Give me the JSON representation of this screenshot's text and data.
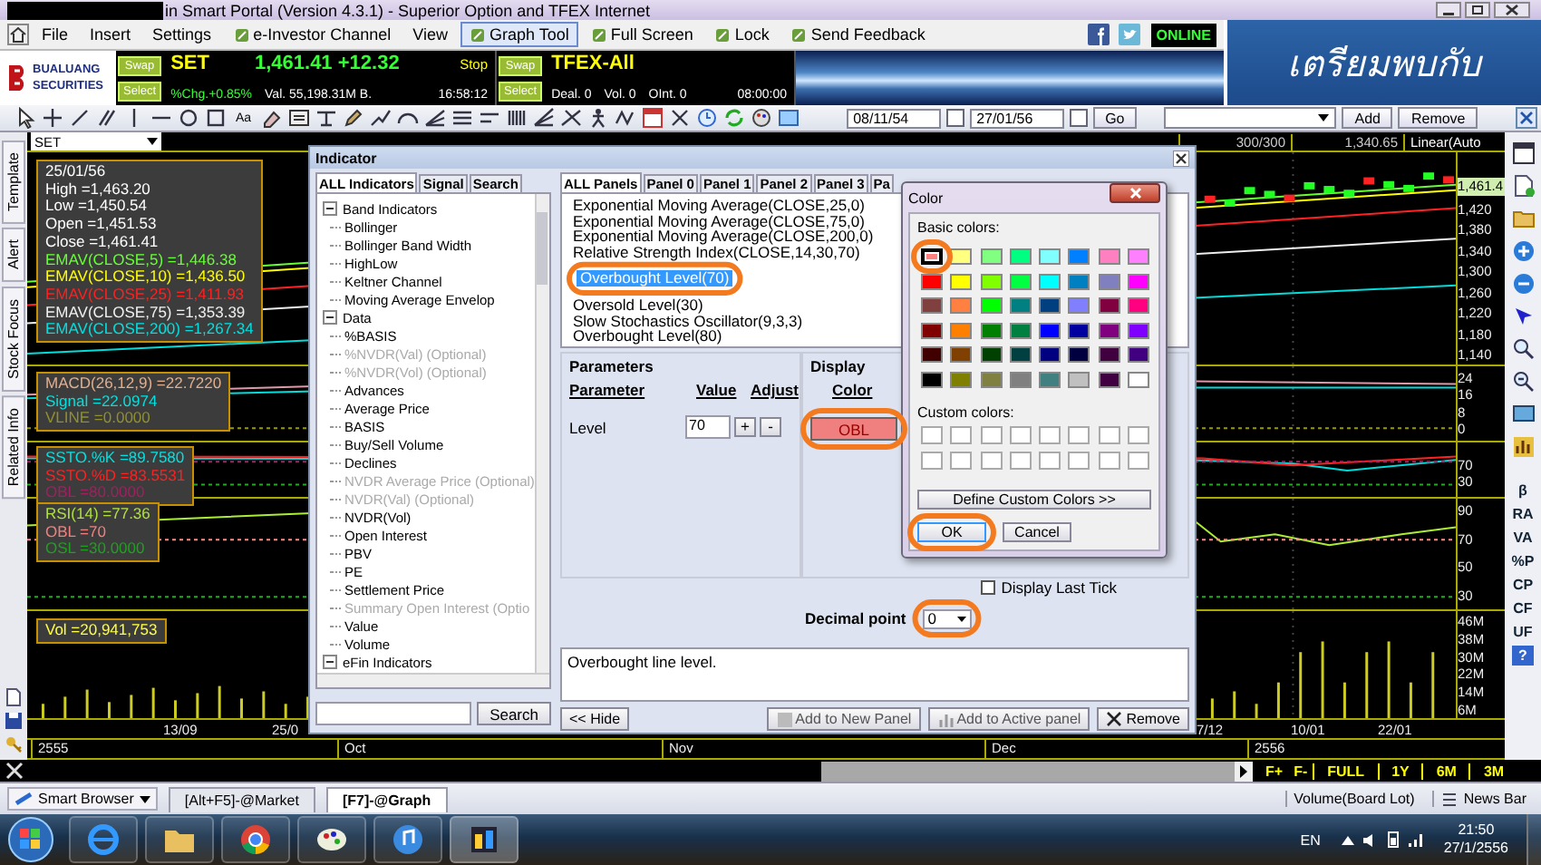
{
  "window": {
    "title": "in Smart Portal (Version 4.3.1) - Superior Option and TFEX Internet"
  },
  "menu": [
    {
      "label": "File",
      "selected": false,
      "icon": false
    },
    {
      "label": "Insert",
      "selected": false,
      "icon": false
    },
    {
      "label": "Settings",
      "selected": false,
      "icon": false
    },
    {
      "label": "e-Investor Channel",
      "selected": false,
      "icon": true
    },
    {
      "label": "View",
      "selected": false,
      "icon": false
    },
    {
      "label": "Graph Tool",
      "selected": true,
      "icon": true
    },
    {
      "label": "Full Screen",
      "selected": false,
      "icon": true
    },
    {
      "label": "Lock",
      "selected": false,
      "icon": true
    },
    {
      "label": "Send Feedback",
      "selected": false,
      "icon": true
    }
  ],
  "status": "ONLINE",
  "banner": "เตรียมพบกับ",
  "broker": {
    "line1": "BUALUANG",
    "line2": "SECURITIES"
  },
  "quotes": [
    {
      "swap": "Swap",
      "select": "Select",
      "symbol": "SET",
      "price": "1,461.41 +12.32",
      "stop": "Stop",
      "stats": [
        {
          "text": "%Chg.+0.85%",
          "color": "#33ff33"
        },
        {
          "text": "Val. 55,198.31M B.",
          "color": "#ffffff"
        }
      ],
      "time": "16:58:12"
    },
    {
      "swap": "Swap",
      "select": "Select",
      "symbol": "TFEX-All",
      "stats": [
        {
          "text": "Deal. 0",
          "color": "#ffffff"
        },
        {
          "text": "Vol. 0",
          "color": "#ffffff"
        },
        {
          "text": "OInt. 0",
          "color": "#ffffff"
        }
      ],
      "time": "08:00:00"
    }
  ],
  "toolbar": {
    "text_tool": "Aa",
    "from_date": "08/11/54",
    "to_date": "27/01/56",
    "go": "Go",
    "add": "Add",
    "remove": "Remove"
  },
  "side_tabs": [
    "Template",
    "Alert",
    "Stock Focus",
    "Related Info"
  ],
  "chart": {
    "symbol": "SET",
    "count": "300/300",
    "cursor_value": "1,340.65",
    "scale": "Linear(Auto",
    "panels": [
      {
        "kind": "price",
        "marker": "1,461.4",
        "ticks": [
          "1,420",
          "1,380",
          "1,340",
          "1,300",
          "1,260",
          "1,220",
          "1,180",
          "1,140"
        ],
        "legend": [
          {
            "text": "25/01/56",
            "color": "#ffffff"
          },
          {
            "text": "High =1,463.20",
            "color": "#ffffff"
          },
          {
            "text": "Low =1,450.54",
            "color": "#ffffff"
          },
          {
            "text": "Open =1,451.53",
            "color": "#ffffff"
          },
          {
            "text": "Close =1,461.41",
            "color": "#ffffff"
          },
          {
            "text": "EMAV(CLOSE,5) =1,446.38",
            "color": "#66ff33"
          },
          {
            "text": "EMAV(CLOSE,10) =1,436.50",
            "color": "#ffff00"
          },
          {
            "text": "EMAV(CLOSE,25) =1,411.93",
            "color": "#ff2020"
          },
          {
            "text": "EMAV(CLOSE,75) =1,353.39",
            "color": "#f0f0f0"
          },
          {
            "text": "EMAV(CLOSE,200) =1,267.34",
            "color": "#00e0e0"
          }
        ]
      },
      {
        "kind": "macd",
        "ticks": [
          "24",
          "16",
          "8",
          "0"
        ],
        "legend": [
          {
            "text": "MACD(26,12,9) =22.7220",
            "color": "#e0b090"
          },
          {
            "text": "Signal =22.0974",
            "color": "#00e0e0"
          },
          {
            "text": "VLINE =0.0000",
            "color": "#909030"
          }
        ]
      },
      {
        "kind": "ssto",
        "ticks": [
          "70",
          "30"
        ],
        "legend": [
          {
            "text": "SSTO.%K =89.7580",
            "color": "#00e0e0"
          },
          {
            "text": "SSTO.%D =83.5531",
            "color": "#ff2020"
          },
          {
            "text": "OBL =80.0000",
            "color": "#a02060"
          }
        ]
      },
      {
        "kind": "rsi",
        "ticks": [
          "90",
          "70",
          "50",
          "30"
        ],
        "legend": [
          {
            "text": "RSI(14) =77.36",
            "color": "#b0e040"
          },
          {
            "text": "OBL =70",
            "color": "#f08080"
          },
          {
            "text": "OSL =30.0000",
            "color": "#20a020"
          }
        ]
      },
      {
        "kind": "volume",
        "ticks": [
          "46M",
          "38M",
          "30M",
          "22M",
          "14M",
          "6M"
        ],
        "legend": [
          {
            "text": "Vol =20,941,753",
            "color": "#ffff40"
          }
        ]
      }
    ],
    "dates": [
      "13/09",
      "25/0",
      "7/12",
      "10/01",
      "22/01"
    ],
    "months": [
      "2555",
      "Oct",
      "Nov",
      "Dec",
      "2556"
    ],
    "range_buttons": [
      "F+",
      "F-",
      "FULL",
      "1Y",
      "6M",
      "3M"
    ]
  },
  "right_tools": [
    "β",
    "RA",
    "VA",
    "%P",
    "CP",
    "CF",
    "UF",
    "?"
  ],
  "indicator_dialog": {
    "title": "Indicator",
    "left_tabs": [
      {
        "label": "ALL Indicators",
        "selected": true
      },
      {
        "label": "Signal",
        "selected": false
      },
      {
        "label": "Search",
        "selected": false
      }
    ],
    "tree": [
      {
        "label": "Band Indicators",
        "expanded": true,
        "children": [
          {
            "label": "Bollinger",
            "disabled": false
          },
          {
            "label": "Bollinger Band Width",
            "disabled": false
          },
          {
            "label": "HighLow",
            "disabled": false
          },
          {
            "label": "Keltner Channel",
            "disabled": false
          },
          {
            "label": "Moving Average Envelop",
            "disabled": false
          }
        ]
      },
      {
        "label": "Data",
        "expanded": true,
        "children": [
          {
            "label": "%BASIS",
            "disabled": false
          },
          {
            "label": "%NVDR(Val) (Optional)",
            "disabled": true
          },
          {
            "label": "%NVDR(Vol) (Optional)",
            "disabled": true
          },
          {
            "label": "Advances",
            "disabled": false
          },
          {
            "label": "Average Price",
            "disabled": false
          },
          {
            "label": "BASIS",
            "disabled": false
          },
          {
            "label": "Buy/Sell Volume",
            "disabled": false
          },
          {
            "label": "Declines",
            "disabled": false
          },
          {
            "label": "NVDR Average Price (Optional)",
            "disabled": true
          },
          {
            "label": "NVDR(Val) (Optional)",
            "disabled": true
          },
          {
            "label": "NVDR(Vol)",
            "disabled": false
          },
          {
            "label": "Open Interest",
            "disabled": false
          },
          {
            "label": "PBV",
            "disabled": false
          },
          {
            "label": "PE",
            "disabled": false
          },
          {
            "label": "Settlement Price",
            "disabled": false
          },
          {
            "label": "Summary Open Interest (Optio",
            "disabled": true
          },
          {
            "label": "Value",
            "disabled": false
          },
          {
            "label": "Volume",
            "disabled": false
          }
        ]
      },
      {
        "label": "eFin Indicators",
        "expanded": true
      }
    ],
    "search_button": "Search",
    "hide_button": "<< Hide",
    "panel_tabs": [
      {
        "label": "ALL Panels",
        "selected": true
      },
      {
        "label": "Panel 0",
        "selected": false
      },
      {
        "label": "Panel 1",
        "selected": false
      },
      {
        "label": "Panel 2",
        "selected": false
      },
      {
        "label": "Panel 3",
        "selected": false
      },
      {
        "label": "Pa",
        "selected": false
      }
    ],
    "panel_items": [
      {
        "label": "Exponential Moving Average(CLOSE,25,0)",
        "selected": false
      },
      {
        "label": "Exponential Moving Average(CLOSE,75,0)",
        "selected": false
      },
      {
        "label": "Exponential Moving Average(CLOSE,200,0)",
        "selected": false
      },
      {
        "label": "Relative Strength Index(CLOSE,14,30,70)",
        "selected": false
      },
      {
        "label": "Overbought Level(70)",
        "selected": true
      },
      {
        "label": "Oversold Level(30)",
        "selected": false
      },
      {
        "label": "Slow Stochastics Oscillator(9,3,3)",
        "selected": false
      },
      {
        "label": "Overbought Level(80)",
        "selected": false
      }
    ],
    "parameters_title": "Parameters",
    "param_headers": [
      "Parameter",
      "Value",
      "Adjust"
    ],
    "params": [
      {
        "name": "Level",
        "value": "70",
        "plus": "+",
        "minus": "-"
      }
    ],
    "display_title": "Display",
    "display_header": "Color",
    "color_button": {
      "label": "OBL",
      "color": "#f08080"
    },
    "last_tick": {
      "label": "Display Last Tick",
      "checked": false
    },
    "decimal": {
      "label": "Decimal point",
      "value": "0"
    },
    "description": "Overbought line level.",
    "actions": [
      "Add to New Panel",
      "Add to Active panel",
      "Remove"
    ]
  },
  "color_dialog": {
    "title": "Color",
    "basic_label": "Basic colors:",
    "custom_label": "Custom colors:",
    "define_button": "Define Custom Colors >>",
    "ok": "OK",
    "cancel": "Cancel",
    "swatches": [
      {
        "color": "#ff8080",
        "selected": true
      },
      {
        "color": "#ffff80",
        "selected": false
      },
      {
        "color": "#80ff80",
        "selected": false
      },
      {
        "color": "#00ff80",
        "selected": false
      },
      {
        "color": "#80ffff",
        "selected": false
      },
      {
        "color": "#0080ff",
        "selected": false
      },
      {
        "color": "#ff80c0",
        "selected": false
      },
      {
        "color": "#ff80ff",
        "selected": false
      },
      {
        "color": "#ff0000",
        "selected": false
      },
      {
        "color": "#ffff00",
        "selected": false
      },
      {
        "color": "#80ff00",
        "selected": false
      },
      {
        "color": "#00ff40",
        "selected": false
      },
      {
        "color": "#00ffff",
        "selected": false
      },
      {
        "color": "#0080c0",
        "selected": false
      },
      {
        "color": "#8080c0",
        "selected": false
      },
      {
        "color": "#ff00ff",
        "selected": false
      },
      {
        "color": "#804040",
        "selected": false
      },
      {
        "color": "#ff8040",
        "selected": false
      },
      {
        "color": "#00ff00",
        "selected": false
      },
      {
        "color": "#008080",
        "selected": false
      },
      {
        "color": "#004080",
        "selected": false
      },
      {
        "color": "#8080ff",
        "selected": false
      },
      {
        "color": "#800040",
        "selected": false
      },
      {
        "color": "#ff0080",
        "selected": false
      },
      {
        "color": "#800000",
        "selected": false
      },
      {
        "color": "#ff8000",
        "selected": false
      },
      {
        "color": "#008000",
        "selected": false
      },
      {
        "color": "#008040",
        "selected": false
      },
      {
        "color": "#0000ff",
        "selected": false
      },
      {
        "color": "#0000a0",
        "selected": false
      },
      {
        "color": "#800080",
        "selected": false
      },
      {
        "color": "#8000ff",
        "selected": false
      },
      {
        "color": "#400000",
        "selected": false
      },
      {
        "color": "#804000",
        "selected": false
      },
      {
        "color": "#004000",
        "selected": false
      },
      {
        "color": "#004040",
        "selected": false
      },
      {
        "color": "#000080",
        "selected": false
      },
      {
        "color": "#000040",
        "selected": false
      },
      {
        "color": "#400040",
        "selected": false
      },
      {
        "color": "#400080",
        "selected": false
      },
      {
        "color": "#000000",
        "selected": false
      },
      {
        "color": "#808000",
        "selected": false
      },
      {
        "color": "#808040",
        "selected": false
      },
      {
        "color": "#808080",
        "selected": false
      },
      {
        "color": "#408080",
        "selected": false
      },
      {
        "color": "#c0c0c0",
        "selected": false
      },
      {
        "color": "#400041",
        "selected": false
      },
      {
        "color": "#ffffff",
        "selected": false
      }
    ]
  },
  "doc_tabs": {
    "browser": "Smart Browser",
    "tabs": [
      {
        "label": "[Alt+F5]-@Market",
        "selected": false
      },
      {
        "label": "[F7]-@Graph",
        "selected": true
      }
    ],
    "status": [
      "Volume(Board Lot)",
      "News Bar"
    ]
  },
  "taskbar": {
    "language": "EN",
    "time": "21:50",
    "date": "27/1/2556"
  }
}
